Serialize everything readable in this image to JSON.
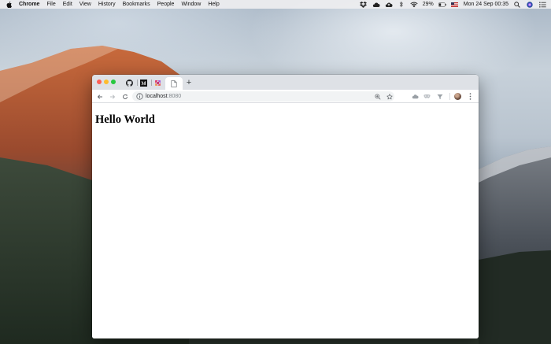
{
  "menubar": {
    "app_name": "Chrome",
    "items": [
      {
        "label": "File"
      },
      {
        "label": "Edit"
      },
      {
        "label": "View"
      },
      {
        "label": "History"
      },
      {
        "label": "Bookmarks"
      },
      {
        "label": "People"
      },
      {
        "label": "Window"
      },
      {
        "label": "Help"
      }
    ],
    "status": {
      "battery": "29%",
      "datetime": "Mon 24 Sep  00:35"
    }
  },
  "browser": {
    "tabs": [
      {
        "icon": "github-icon"
      },
      {
        "icon": "medium-icon"
      },
      {
        "icon": "app-icon"
      },
      {
        "icon": "blank-page-icon",
        "active": true
      }
    ],
    "new_tab_label": "+",
    "address": {
      "host": "localhost",
      "port": ":8080"
    },
    "accent": "#dee1e6"
  },
  "page": {
    "heading": "Hello World"
  }
}
